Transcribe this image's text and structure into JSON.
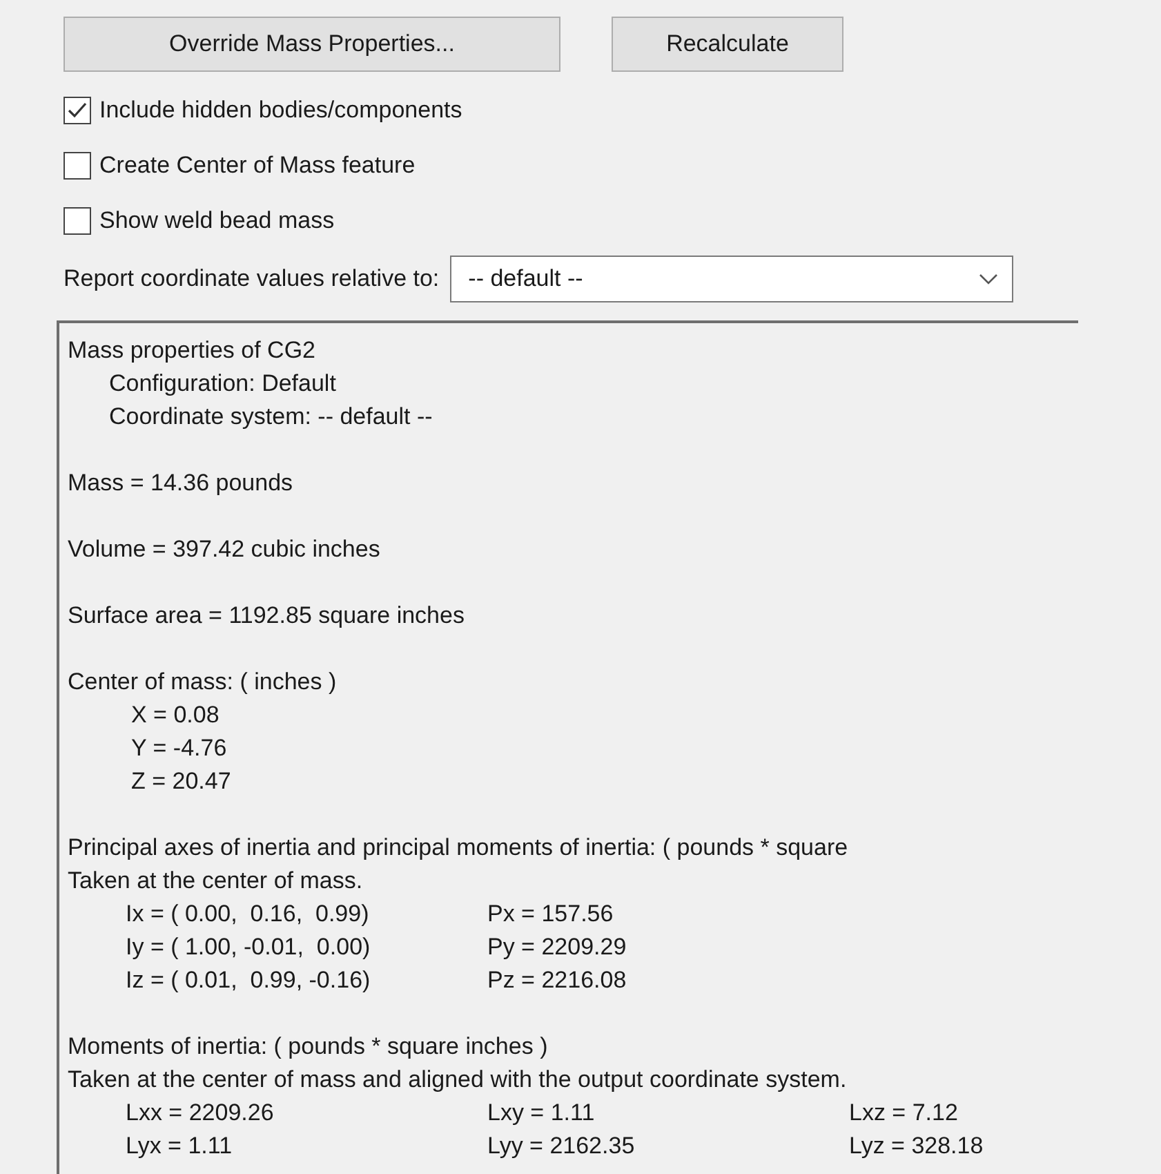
{
  "buttons": [
    {
      "label": "Override Mass Properties..."
    },
    {
      "label": "Recalculate"
    }
  ],
  "options": [
    {
      "label": "Include hidden bodies/components",
      "checked": true
    },
    {
      "label": "Create Center of Mass feature",
      "checked": false
    },
    {
      "label": "Show weld bead mass",
      "checked": false
    }
  ],
  "coordinate_select": {
    "label": "Report coordinate values relative to:",
    "value": "-- default --"
  },
  "report": {
    "sections": [
      {
        "lines": [
          {
            "kind": "line",
            "text": "Mass properties of CG2"
          },
          {
            "kind": "sub",
            "text": "Configuration: Default"
          },
          {
            "kind": "sub",
            "text": "Coordinate system: -- default --"
          }
        ]
      },
      {
        "lines": [
          {
            "kind": "line",
            "text": "Mass = 14.36 pounds"
          }
        ]
      },
      {
        "lines": [
          {
            "kind": "line",
            "text": "Volume = 397.42 cubic inches"
          }
        ]
      },
      {
        "lines": [
          {
            "kind": "line",
            "text": "Surface area = 1192.85 square inches"
          }
        ]
      },
      {
        "lines": [
          {
            "kind": "line",
            "text": "Center of mass: ( inches )"
          },
          {
            "kind": "sub2",
            "text": "X = 0.08"
          },
          {
            "kind": "sub2",
            "text": "Y = -4.76"
          },
          {
            "kind": "sub2",
            "text": "Z = 20.47"
          }
        ]
      },
      {
        "lines": [
          {
            "kind": "line",
            "text": "Principal axes of inertia and principal moments of inertia: ( pounds * square"
          },
          {
            "kind": "line",
            "text": "Taken at the center of mass."
          },
          {
            "kind": "row",
            "cells": [
              "Ix = ( 0.00,  0.16,  0.99)",
              "Px = 157.56"
            ]
          },
          {
            "kind": "row",
            "cells": [
              "Iy = ( 1.00, -0.01,  0.00)",
              "Py = 2209.29"
            ]
          },
          {
            "kind": "row",
            "cells": [
              "Iz = ( 0.01,  0.99, -0.16)",
              "Pz = 2216.08"
            ]
          }
        ]
      },
      {
        "lines": [
          {
            "kind": "line",
            "text": "Moments of inertia: ( pounds * square inches )"
          },
          {
            "kind": "line",
            "text": "Taken at the center of mass and aligned with the output coordinate system."
          },
          {
            "kind": "row",
            "cells": [
              "Lxx = 2209.26",
              "Lxy = 1.11",
              "Lxz = 7.12"
            ]
          },
          {
            "kind": "row",
            "cells": [
              "Lyx = 1.11",
              "Lyy = 2162.35",
              "Lyz = 328.18"
            ]
          }
        ]
      }
    ]
  }
}
